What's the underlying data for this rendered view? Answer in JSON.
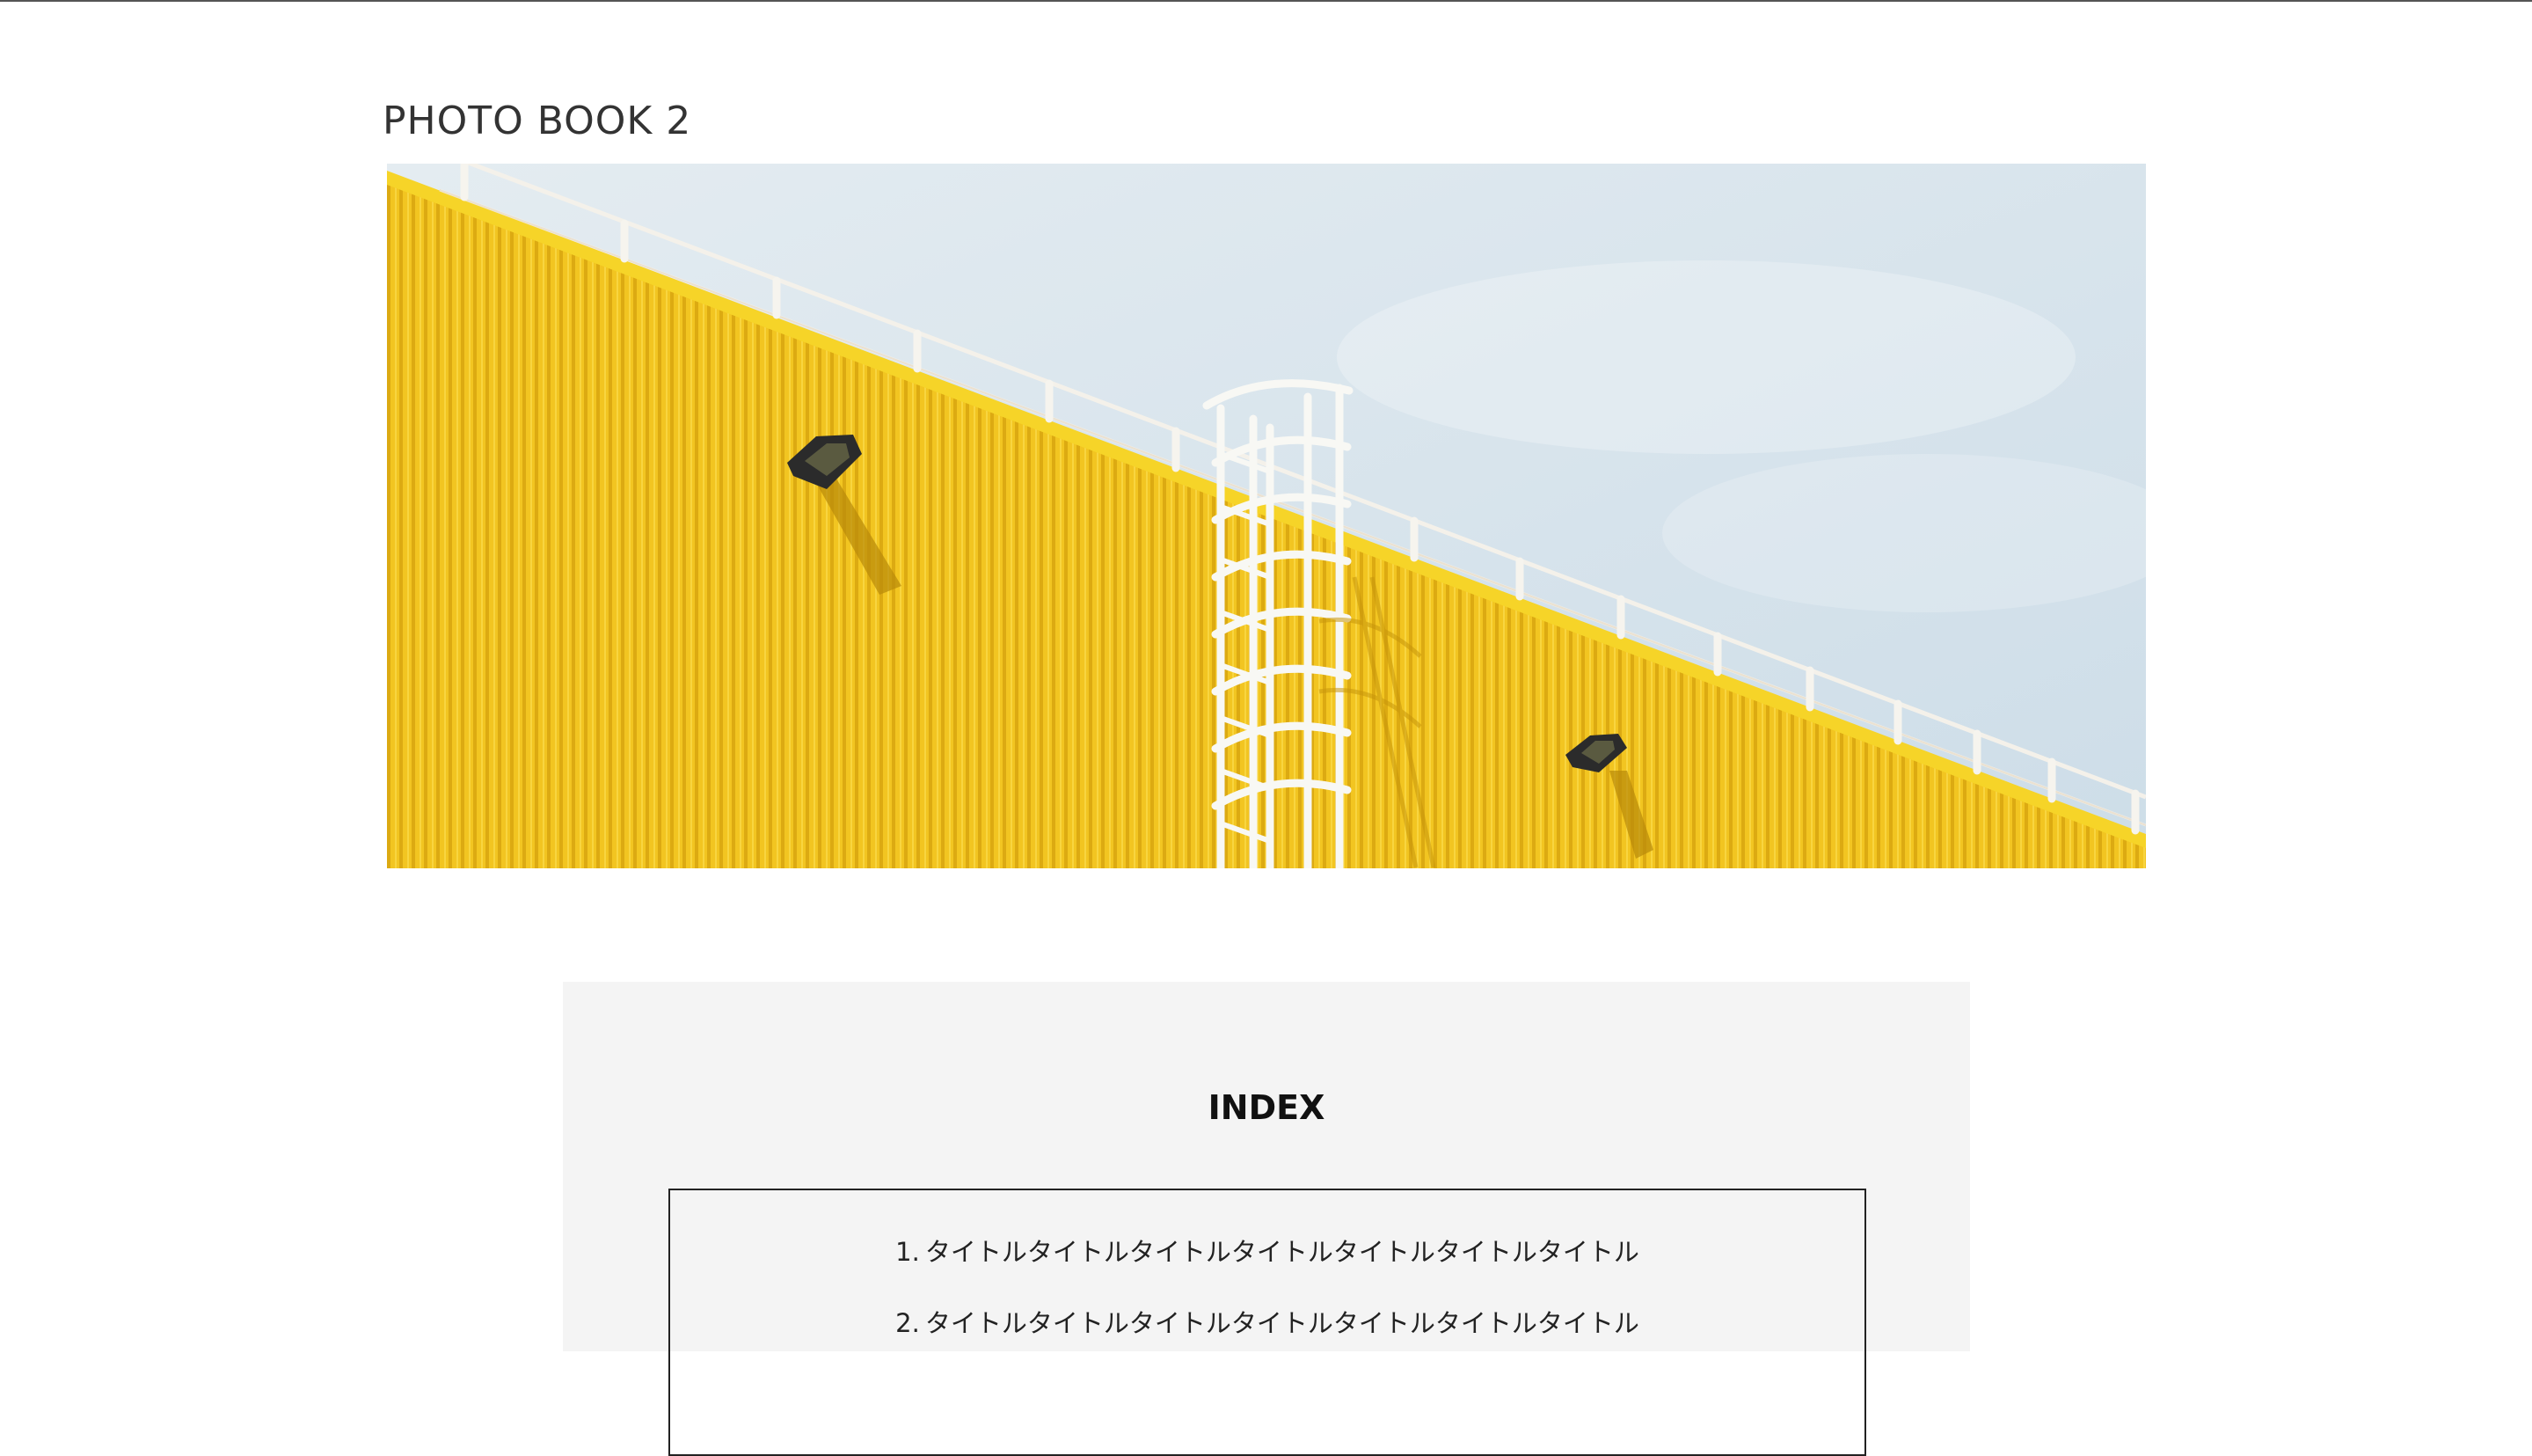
{
  "page": {
    "title": "PHOTO BOOK 2"
  },
  "hero": {
    "subject": "yellow-building-with-ladder-photo",
    "colors": {
      "sky": "#d3e2eb",
      "wall": "#f3c61f",
      "wall_shadow": "#d9a90f",
      "rail": "#f7f7f2",
      "lamp": "#2b2b2b"
    }
  },
  "index": {
    "title": "INDEX",
    "items": [
      {
        "number": "1.",
        "label": "タイトルタイトルタイトルタイトルタイトルタイトルタイトル"
      },
      {
        "number": "2.",
        "label": "タイトルタイトルタイトルタイトルタイトルタイトルタイトル"
      }
    ]
  }
}
